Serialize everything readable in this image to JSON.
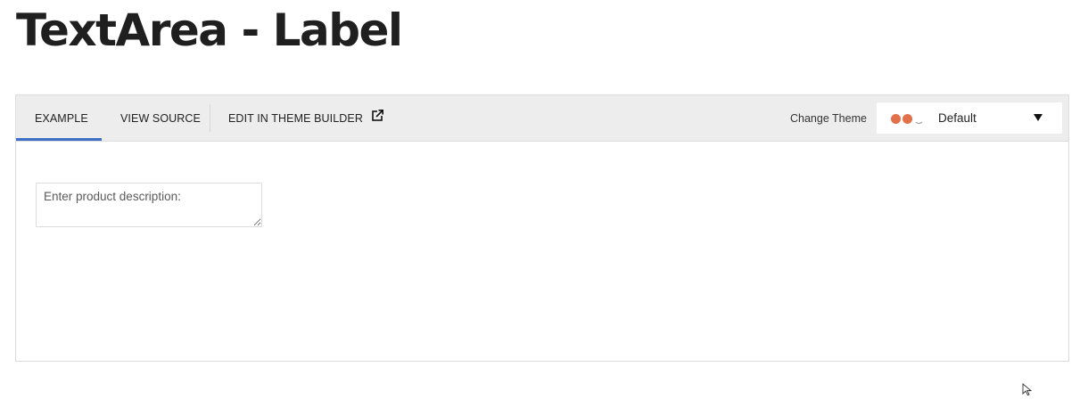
{
  "page": {
    "title": "TextArea - Label"
  },
  "toolbar": {
    "tabs": [
      {
        "label": "EXAMPLE",
        "active": true
      },
      {
        "label": "VIEW SOURCE",
        "active": false
      },
      {
        "label": "EDIT IN THEME BUILDER",
        "active": false,
        "icon": "external-link-icon"
      }
    ],
    "change_theme_label": "Change Theme",
    "theme_select": {
      "value": "Default",
      "swatch_colors": [
        "#e2714b",
        "#e2714b"
      ],
      "icon": "chevron-down-icon"
    }
  },
  "demo": {
    "textarea": {
      "placeholder": "Enter product description:",
      "value": ""
    }
  },
  "colors": {
    "accent": "#3d6fc6",
    "toolbar_bg": "#ededed"
  }
}
